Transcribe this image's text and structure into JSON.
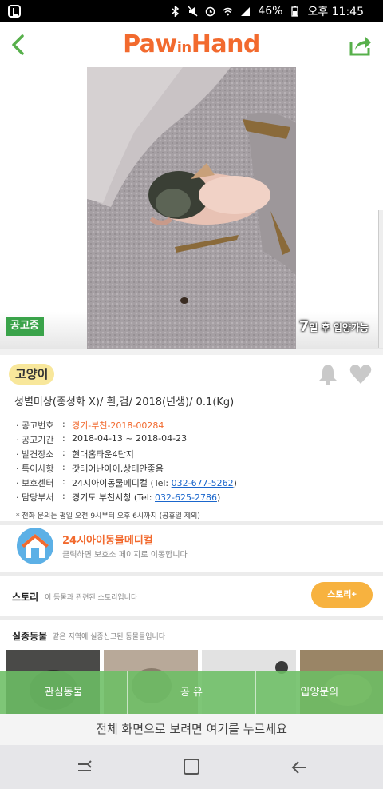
{
  "status_bar": {
    "battery_percent": "46%",
    "time": "오후 11:45"
  },
  "header": {
    "logo_text_1": "Paw",
    "logo_text_small": "in",
    "logo_text_2": "Hand"
  },
  "hero": {
    "notice_badge": "공고중",
    "days_number": "7",
    "days_text": "일 후 입양가능"
  },
  "animal": {
    "species": "고양이",
    "summary": "성별미상(중성화 X)/ 흰,검/ 2018(년생)/ 0.1(Kg)"
  },
  "details": {
    "notice_no_label": "공고번호",
    "notice_no": "경기-부천-2018-00284",
    "period_label": "공고기간",
    "period": "2018-04-13 ~ 2018-04-23",
    "found_label": "발견장소",
    "found": "현대홈타운4단지",
    "special_label": "특이사항",
    "special": "갓태어난아이,상태안좋음",
    "center_label": "보호센터",
    "center_name": "24시아이동물메디컬",
    "center_tel_prefix": "(Tel: ",
    "center_tel": "032-677-5262",
    "center_tel_suffix": ")",
    "dept_label": "담당부서",
    "dept_name": "경기도 부천시청",
    "dept_tel_prefix": "(Tel: ",
    "dept_tel": "032-625-2786",
    "dept_tel_suffix": ")",
    "note": "* 전화 문의는 평일 오전 9시부터 오후 6시까지 (공휴일 제외)"
  },
  "shelter": {
    "name": "24시아이동물메디컬",
    "subtitle": "클릭하면 보호소 페이지로 이동합니다"
  },
  "story": {
    "title": "스토리",
    "desc": "이 동물과 관련된 스토리입니다",
    "button": "스토리+"
  },
  "missing": {
    "title": "실종동물",
    "desc": "같은 지역에 실종신고된 동물들입니다"
  },
  "actions": {
    "interest": "관심동물",
    "share": "공 유",
    "adopt": "입양문의"
  },
  "fullscreen": {
    "text": "전체 화면으로 보려면 여기를 누르세요"
  },
  "colors": {
    "brand_orange": "#f26a2e",
    "green": "#3aa34a",
    "action_green": "#6cbe64",
    "story_btn": "#f7b23f",
    "species_badge": "#f8e79b"
  }
}
